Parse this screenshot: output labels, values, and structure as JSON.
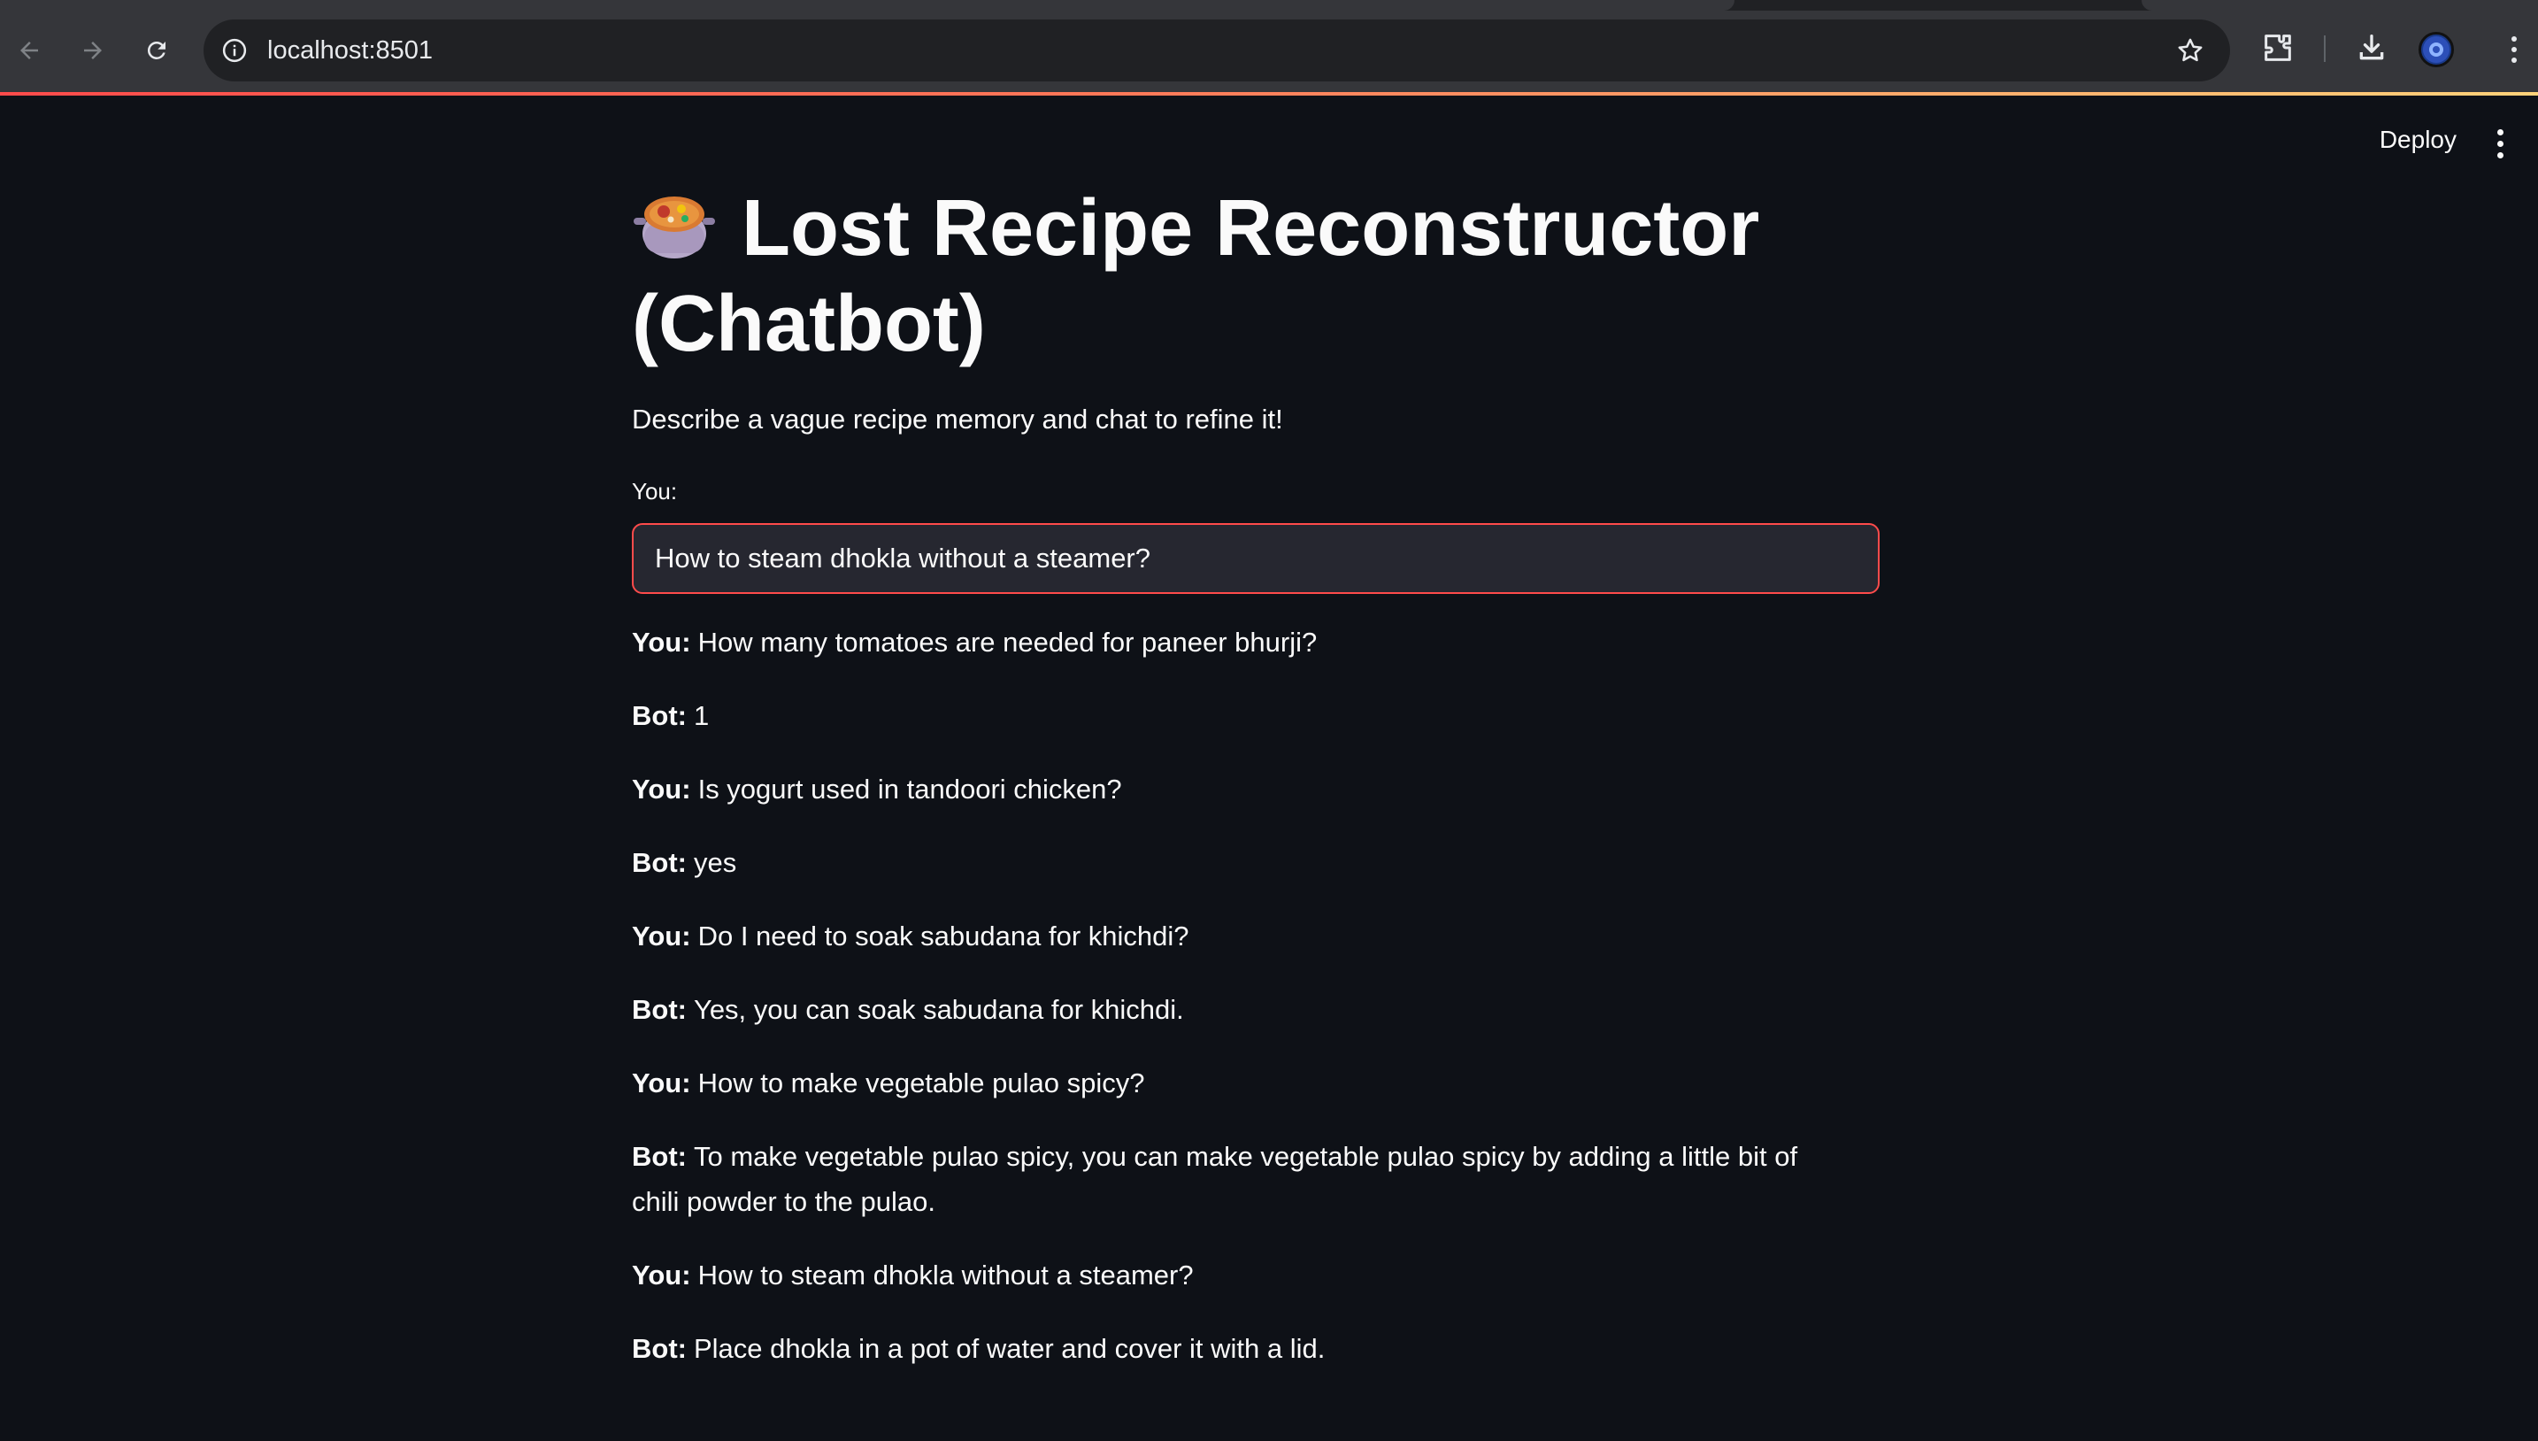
{
  "browser": {
    "url": "localhost:8501"
  },
  "app": {
    "deploy_label": "Deploy",
    "title": "Lost Recipe Reconstructor (Chatbot)",
    "subtitle": "Describe a vague recipe memory and chat to refine it!",
    "input": {
      "label": "You:",
      "value": "How to steam dhokla without a steamer?"
    },
    "messages": [
      {
        "speaker": "You:",
        "text": "How many tomatoes are needed for paneer bhurji?"
      },
      {
        "speaker": "Bot:",
        "text": "1"
      },
      {
        "speaker": "You:",
        "text": "Is yogurt used in tandoori chicken?"
      },
      {
        "speaker": "Bot:",
        "text": "yes"
      },
      {
        "speaker": "You:",
        "text": "Do I need to soak sabudana for khichdi?"
      },
      {
        "speaker": "Bot:",
        "text": "Yes, you can soak sabudana for khichdi."
      },
      {
        "speaker": "You:",
        "text": "How to make vegetable pulao spicy?"
      },
      {
        "speaker": "Bot:",
        "text": "To make vegetable pulao spicy, you can make vegetable pulao spicy by adding a little bit of chili powder to the pulao."
      },
      {
        "speaker": "You:",
        "text": "How to steam dhokla without a steamer?"
      },
      {
        "speaker": "Bot:",
        "text": "Place dhokla in a pot of water and cover it with a lid."
      }
    ]
  },
  "colors": {
    "background": "#0e1117",
    "accent": "#ff4b4b",
    "text": "#fafafa",
    "input_bg": "#262730"
  },
  "icons": {
    "title_icon": "pot-of-food-icon"
  }
}
